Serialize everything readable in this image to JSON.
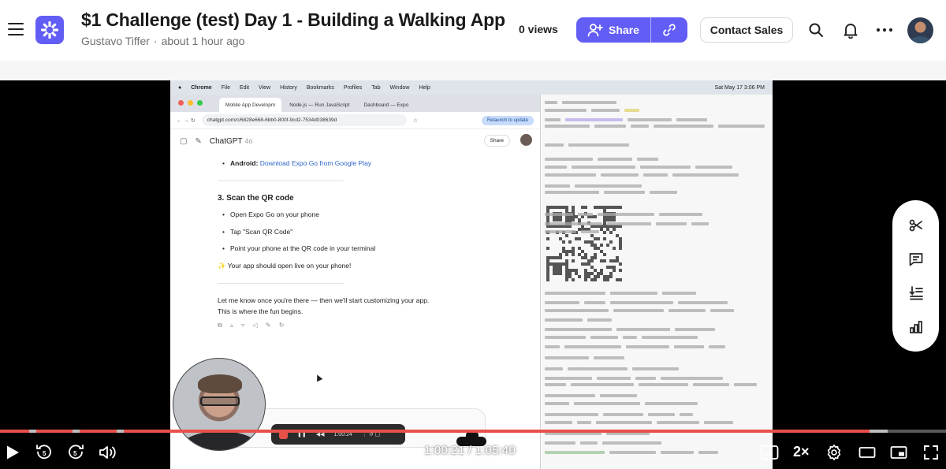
{
  "header": {
    "title": "$1 Challenge (test) Day 1 - Building a Walking App",
    "author": "Gustavo Tiffer",
    "time_ago": "about 1 hour ago",
    "views": "0 views",
    "share_label": "Share",
    "contact_label": "Contact Sales"
  },
  "screen": {
    "mac_menu": [
      "Chrome",
      "File",
      "Edit",
      "View",
      "History",
      "Bookmarks",
      "Profiles",
      "Tab",
      "Window",
      "Help"
    ],
    "mac_clock": "Sat May 17  3:06 PM",
    "tabs": [
      "Mobile App Developm",
      "Node.js — Run JavaScript",
      "Dashboard — Expo"
    ],
    "url": "chatgpt.com/c/6828e668-6bb0-800f-9cd2-7534d038639d",
    "relaunch_label": "Relaunch to update",
    "model_name": "ChatGPT",
    "model_version": "4o",
    "chat_share": "Share",
    "android_prefix": "Android:",
    "android_link": "Download Expo Go from Google Play",
    "step_heading": "3. Scan the QR code",
    "step_items": [
      "Open Expo Go on your phone",
      "Tap \"Scan QR Code\"",
      "Point your phone at the QR code in your terminal"
    ],
    "live_note": "✨ Your app should open live on your phone!",
    "closing_line_1": "Let me know once you're there — then we'll start customizing your app.",
    "closing_line_2": "This is where the fun begins.",
    "rec_time": "1:00:24"
  },
  "player": {
    "current_time": "1:00:21",
    "duration": "1:05:40",
    "time_display": "1:00:21 / 1:05:40",
    "playback_speed": "2×",
    "progress_fraction": 0.919,
    "buffered_fraction": 0.938,
    "accent_color": "#e8504a"
  },
  "brand": {
    "accent": "#625df5"
  },
  "icons": {
    "menu": "hamburger-icon",
    "logo": "loom-logo-icon",
    "share": "add-person-icon",
    "link": "link-icon",
    "search": "search-icon",
    "notifications": "bell-icon",
    "more": "more-horizontal-icon",
    "rail": [
      "scissors-icon",
      "comment-icon",
      "transcript-icon",
      "insights-icon"
    ],
    "controls": [
      "play-icon",
      "rewind-5-icon",
      "forward-5-icon",
      "volume-icon",
      "captions-icon",
      "settings-icon",
      "theater-icon",
      "pip-icon",
      "fullscreen-icon"
    ]
  }
}
